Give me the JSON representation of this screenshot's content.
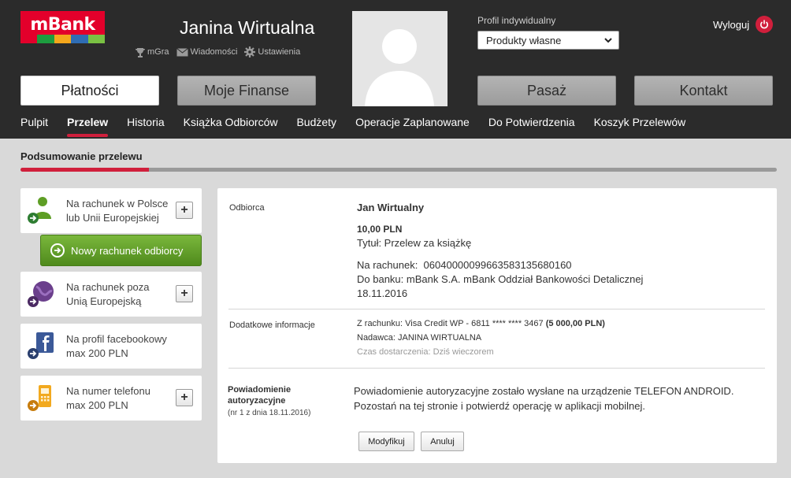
{
  "brand": {
    "logo_text": "mBank",
    "colors": {
      "primary": "#e3002b",
      "stripe": [
        "#e3002b",
        "#1d9d3f",
        "#f4a71c",
        "#2f6db4",
        "#7ac143"
      ],
      "accent": "#d01f3c",
      "green": "#5e9e25"
    }
  },
  "header": {
    "user_name": "Janina Wirtualna",
    "links": [
      {
        "label": "mGra",
        "icon": "trophy-icon"
      },
      {
        "label": "Wiadomości",
        "icon": "envelope-icon"
      },
      {
        "label": "Ustawienia",
        "icon": "gear-icon"
      }
    ],
    "profile_label": "Profil indywidualny",
    "profile_selected": "Produkty własne",
    "logout_label": "Wyloguj"
  },
  "main_tabs": [
    "Płatności",
    "Moje Finanse",
    "Pasaż",
    "Kontakt"
  ],
  "sub_nav": [
    "Pulpit",
    "Przelew",
    "Historia",
    "Książka Odbiorców",
    "Budżety",
    "Operacje Zaplanowane",
    "Do Potwierdzenia",
    "Koszyk Przelewów"
  ],
  "page": {
    "section_title": "Podsumowanie przelewu",
    "progress_fraction": 0.17
  },
  "left_menu": {
    "cards": [
      {
        "line1": "Na rachunek w Polsce",
        "line2": "lub Unii Europejskiej",
        "icon": "person-transfer-icon"
      },
      {
        "line1": "Na rachunek poza",
        "line2": "Unią Europejską",
        "icon": "globe-transfer-icon"
      },
      {
        "line1": "Na profil facebookowy",
        "line2": "max 200 PLN",
        "icon": "facebook-transfer-icon"
      },
      {
        "line1": "Na numer telefonu",
        "line2": "max 200 PLN",
        "icon": "phone-transfer-icon"
      }
    ],
    "new_account_button": "Nowy rachunek odbiorcy",
    "plus": "+"
  },
  "summary": {
    "recipient_label": "Odbiorca",
    "recipient_name": "Jan Wirtualny",
    "amount": "10,00 PLN",
    "title_line": "Tytuł: Przelew za książkę",
    "account_line": "Na rachunek:  06040000099663583135680160",
    "bank_line": "Do banku: mBank S.A. mBank Oddział Bankowości Detalicznej",
    "date": "18.11.2016",
    "extra_label": "Dodatkowe informacje",
    "from_label": "Z rachunku:",
    "from_value": "Visa Credit WP - 6811 **** **** 3467",
    "from_balance": "(5 000,00 PLN)",
    "sender_label": "Nadawca:",
    "sender_value": "JANINA WIRTUALNA",
    "delivery_label": "Czas dostarczenia:",
    "delivery_value": "Dziś wieczorem",
    "notice_label_1": "Powiadomienie",
    "notice_label_2": "autoryzacyjne",
    "notice_sub": "(nr 1 z dnia 18.11.2016)",
    "notice_text_1": "Powiadomienie autoryzacyjne zostało wysłane na urządzenie TELEFON ANDROID.",
    "notice_text_2": "Pozostań na tej stronie i potwierdź operację w aplikacji mobilnej.",
    "modify_button": "Modyfikuj",
    "cancel_button": "Anuluj"
  }
}
